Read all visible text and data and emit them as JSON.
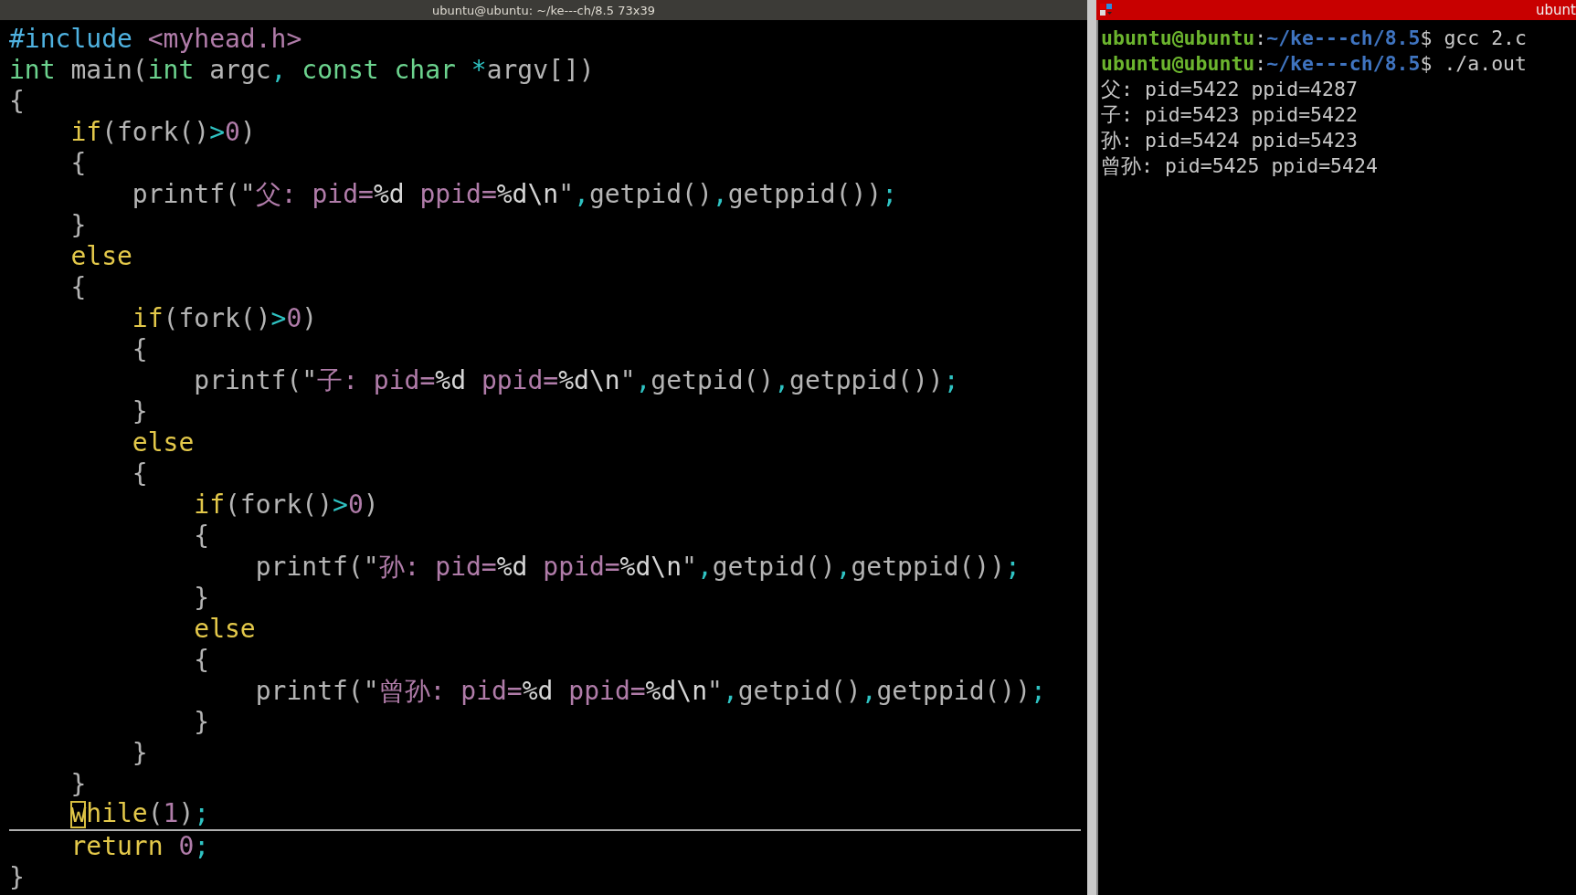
{
  "editor": {
    "title": "ubuntu@ubuntu: ~/ke---ch/8.5 73x39",
    "lines": [
      {
        "current": false,
        "tokens": [
          {
            "text": "#include",
            "kind": "preproc"
          },
          {
            "text": " <myhead.h>",
            "kind": "string"
          }
        ]
      },
      {
        "current": false,
        "tokens": [
          {
            "text": "int",
            "kind": "type"
          },
          {
            "text": " main(",
            "kind": "plain"
          },
          {
            "text": "int",
            "kind": "type"
          },
          {
            "text": " argc",
            "kind": "plain"
          },
          {
            "text": ",",
            "kind": "op"
          },
          {
            "text": " const",
            "kind": "type"
          },
          {
            "text": " char",
            "kind": "type"
          },
          {
            "text": " *",
            "kind": "op"
          },
          {
            "text": "argv[])",
            "kind": "plain"
          }
        ]
      },
      {
        "current": false,
        "tokens": [
          {
            "text": "{",
            "kind": "plain"
          }
        ]
      },
      {
        "current": false,
        "tokens": [
          {
            "text": "    if",
            "kind": "keyword"
          },
          {
            "text": "(fork()",
            "kind": "plain"
          },
          {
            "text": ">",
            "kind": "op"
          },
          {
            "text": "0",
            "kind": "number"
          },
          {
            "text": ")",
            "kind": "plain"
          }
        ]
      },
      {
        "current": false,
        "tokens": [
          {
            "text": "    {",
            "kind": "plain"
          }
        ]
      },
      {
        "current": false,
        "tokens": [
          {
            "text": "        printf(\"",
            "kind": "plain"
          },
          {
            "text": "父: pid=",
            "kind": "string"
          },
          {
            "text": "%d",
            "kind": "special"
          },
          {
            "text": " ppid=",
            "kind": "string"
          },
          {
            "text": "%d\\n",
            "kind": "special"
          },
          {
            "text": "\"",
            "kind": "plain"
          },
          {
            "text": ",",
            "kind": "op"
          },
          {
            "text": "getpid()",
            "kind": "plain"
          },
          {
            "text": ",",
            "kind": "op"
          },
          {
            "text": "getppid())",
            "kind": "plain"
          },
          {
            "text": ";",
            "kind": "op"
          }
        ]
      },
      {
        "current": false,
        "tokens": [
          {
            "text": "    }",
            "kind": "plain"
          }
        ]
      },
      {
        "current": false,
        "tokens": [
          {
            "text": "    else",
            "kind": "keyword"
          }
        ]
      },
      {
        "current": false,
        "tokens": [
          {
            "text": "    {",
            "kind": "plain"
          }
        ]
      },
      {
        "current": false,
        "tokens": [
          {
            "text": "        if",
            "kind": "keyword"
          },
          {
            "text": "(fork()",
            "kind": "plain"
          },
          {
            "text": ">",
            "kind": "op"
          },
          {
            "text": "0",
            "kind": "number"
          },
          {
            "text": ")",
            "kind": "plain"
          }
        ]
      },
      {
        "current": false,
        "tokens": [
          {
            "text": "        {",
            "kind": "plain"
          }
        ]
      },
      {
        "current": false,
        "tokens": [
          {
            "text": "            printf(\"",
            "kind": "plain"
          },
          {
            "text": "子: pid=",
            "kind": "string"
          },
          {
            "text": "%d",
            "kind": "special"
          },
          {
            "text": " ppid=",
            "kind": "string"
          },
          {
            "text": "%d\\n",
            "kind": "special"
          },
          {
            "text": "\"",
            "kind": "plain"
          },
          {
            "text": ",",
            "kind": "op"
          },
          {
            "text": "getpid()",
            "kind": "plain"
          },
          {
            "text": ",",
            "kind": "op"
          },
          {
            "text": "getppid())",
            "kind": "plain"
          },
          {
            "text": ";",
            "kind": "op"
          }
        ]
      },
      {
        "current": false,
        "tokens": [
          {
            "text": "        }",
            "kind": "plain"
          }
        ]
      },
      {
        "current": false,
        "tokens": [
          {
            "text": "        else",
            "kind": "keyword"
          }
        ]
      },
      {
        "current": false,
        "tokens": [
          {
            "text": "        {",
            "kind": "plain"
          }
        ]
      },
      {
        "current": false,
        "tokens": [
          {
            "text": "            if",
            "kind": "keyword"
          },
          {
            "text": "(fork()",
            "kind": "plain"
          },
          {
            "text": ">",
            "kind": "op"
          },
          {
            "text": "0",
            "kind": "number"
          },
          {
            "text": ")",
            "kind": "plain"
          }
        ]
      },
      {
        "current": false,
        "tokens": [
          {
            "text": "            {",
            "kind": "plain"
          }
        ]
      },
      {
        "current": false,
        "tokens": [
          {
            "text": "                printf(\"",
            "kind": "plain"
          },
          {
            "text": "孙: pid=",
            "kind": "string"
          },
          {
            "text": "%d",
            "kind": "special"
          },
          {
            "text": " ppid=",
            "kind": "string"
          },
          {
            "text": "%d\\n",
            "kind": "special"
          },
          {
            "text": "\"",
            "kind": "plain"
          },
          {
            "text": ",",
            "kind": "op"
          },
          {
            "text": "getpid()",
            "kind": "plain"
          },
          {
            "text": ",",
            "kind": "op"
          },
          {
            "text": "getppid())",
            "kind": "plain"
          },
          {
            "text": ";",
            "kind": "op"
          }
        ]
      },
      {
        "current": false,
        "tokens": [
          {
            "text": "            }",
            "kind": "plain"
          }
        ]
      },
      {
        "current": false,
        "tokens": [
          {
            "text": "            else",
            "kind": "keyword"
          }
        ]
      },
      {
        "current": false,
        "tokens": [
          {
            "text": "            {",
            "kind": "plain"
          }
        ]
      },
      {
        "current": false,
        "tokens": [
          {
            "text": "                printf(\"",
            "kind": "plain"
          },
          {
            "text": "曾孙: pid=",
            "kind": "string"
          },
          {
            "text": "%d",
            "kind": "special"
          },
          {
            "text": " ppid=",
            "kind": "string"
          },
          {
            "text": "%d\\n",
            "kind": "special"
          },
          {
            "text": "\"",
            "kind": "plain"
          },
          {
            "text": ",",
            "kind": "op"
          },
          {
            "text": "getpid()",
            "kind": "plain"
          },
          {
            "text": ",",
            "kind": "op"
          },
          {
            "text": "getppid())",
            "kind": "plain"
          },
          {
            "text": ";",
            "kind": "op"
          }
        ]
      },
      {
        "current": false,
        "tokens": [
          {
            "text": "            }",
            "kind": "plain"
          }
        ]
      },
      {
        "current": false,
        "tokens": [
          {
            "text": "        }",
            "kind": "plain"
          }
        ]
      },
      {
        "current": false,
        "tokens": [
          {
            "text": "    }",
            "kind": "plain"
          }
        ]
      },
      {
        "current": true,
        "tokens": [
          {
            "text": "    w",
            "kind": "keyword",
            "cursor": true
          },
          {
            "text": "hile",
            "kind": "keyword"
          },
          {
            "text": "(",
            "kind": "plain"
          },
          {
            "text": "1",
            "kind": "number"
          },
          {
            "text": ")",
            "kind": "plain"
          },
          {
            "text": ";",
            "kind": "op"
          }
        ]
      },
      {
        "current": false,
        "tokens": [
          {
            "text": "    return",
            "kind": "keyword"
          },
          {
            "text": " 0",
            "kind": "number"
          },
          {
            "text": ";",
            "kind": "op"
          }
        ]
      },
      {
        "current": false,
        "tokens": [
          {
            "text": "}",
            "kind": "plain"
          }
        ]
      }
    ]
  },
  "terminal": {
    "title": "ubunt",
    "lines": [
      {
        "kind": "prompt",
        "user": "ubuntu@ubuntu",
        "sep": ":",
        "path": "~/ke---ch/8.5",
        "rest": "$ gcc 2.c"
      },
      {
        "kind": "prompt",
        "user": "ubuntu@ubuntu",
        "sep": ":",
        "path": "~/ke---ch/8.5",
        "rest": "$ ./a.out"
      },
      {
        "kind": "output",
        "text": "父: pid=5422 ppid=4287"
      },
      {
        "kind": "output",
        "text": "子: pid=5423 ppid=5422"
      },
      {
        "kind": "output",
        "text": "孙: pid=5424 ppid=5423"
      },
      {
        "kind": "output",
        "text": "曾孙: pid=5425 ppid=5424"
      }
    ]
  }
}
